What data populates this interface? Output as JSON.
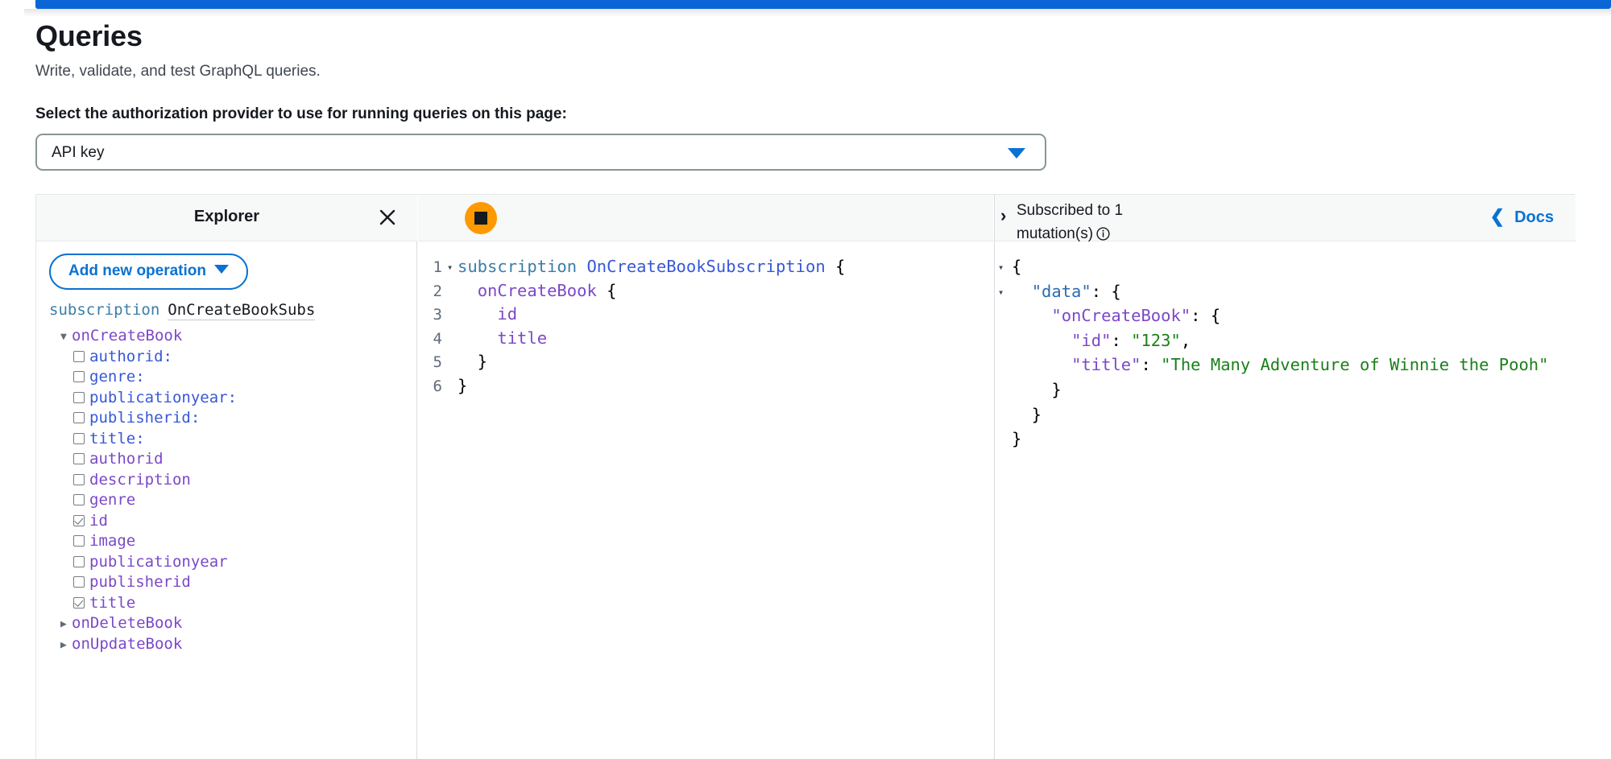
{
  "topbar": {
    "color": "#0a66d6"
  },
  "page": {
    "title": "Queries",
    "subtitle": "Write, validate, and test GraphQL queries.",
    "auth_label": "Select the authorization provider to use for running queries on this page:"
  },
  "auth_select": {
    "value": "API key",
    "options": [
      "API key"
    ],
    "arrow_icon": "chevron-down-icon"
  },
  "explorer": {
    "title": "Explorer",
    "close_icon": "close-icon",
    "add_operation_label": "Add new operation",
    "add_operation_caret": "chevron-down-icon",
    "operation_keyword": "subscription",
    "operation_name": "OnCreateBookSubs",
    "tree": [
      {
        "label": "onCreateBook",
        "kind": "expanded-root",
        "triangle": "▼",
        "color": "purple",
        "level": 0
      },
      {
        "label": "authorid:",
        "kind": "arg",
        "checked": false,
        "color": "blue",
        "level": 1
      },
      {
        "label": "genre:",
        "kind": "arg",
        "checked": false,
        "color": "blue",
        "level": 1
      },
      {
        "label": "publicationyear:",
        "kind": "arg",
        "checked": false,
        "color": "blue",
        "level": 1
      },
      {
        "label": "publisherid:",
        "kind": "arg",
        "checked": false,
        "color": "blue",
        "level": 1
      },
      {
        "label": "title:",
        "kind": "arg",
        "checked": false,
        "color": "blue",
        "level": 1
      },
      {
        "label": "authorid",
        "kind": "field",
        "checked": false,
        "color": "purple",
        "level": 1
      },
      {
        "label": "description",
        "kind": "field",
        "checked": false,
        "color": "purple",
        "level": 1
      },
      {
        "label": "genre",
        "kind": "field",
        "checked": false,
        "color": "purple",
        "level": 1
      },
      {
        "label": "id",
        "kind": "field",
        "checked": true,
        "color": "purple",
        "level": 1
      },
      {
        "label": "image",
        "kind": "field",
        "checked": false,
        "color": "purple",
        "level": 1
      },
      {
        "label": "publicationyear",
        "kind": "field",
        "checked": false,
        "color": "purple",
        "level": 1
      },
      {
        "label": "publisherid",
        "kind": "field",
        "checked": false,
        "color": "purple",
        "level": 1
      },
      {
        "label": "title",
        "kind": "field",
        "checked": true,
        "color": "purple",
        "level": 1
      },
      {
        "label": "onDeleteBook",
        "kind": "collapsed-root",
        "triangle": "▶",
        "color": "purple",
        "level": 0
      },
      {
        "label": "onUpdateBook",
        "kind": "collapsed-root",
        "triangle": "▶",
        "color": "purple",
        "level": 0
      }
    ]
  },
  "editor": {
    "stop_button_icon": "stop-icon",
    "stop_button_color": "#ff9900",
    "lines": [
      {
        "number": "1",
        "fold": "▾",
        "text": "subscription OnCreateBookSubscription {"
      },
      {
        "number": "2",
        "fold": "",
        "text": "  onCreateBook {"
      },
      {
        "number": "3",
        "fold": "",
        "text": "    id"
      },
      {
        "number": "4",
        "fold": "",
        "text": "    title"
      },
      {
        "number": "5",
        "fold": "",
        "text": "  }"
      },
      {
        "number": "6",
        "fold": "",
        "text": "}"
      }
    ]
  },
  "result": {
    "left_chevron": "›",
    "status_text": "Subscribed to 1 mutation(s)",
    "info_icon": "info-icon",
    "docs_label": "Docs",
    "docs_chevron": "chevron-left-icon",
    "json": {
      "data": {
        "onCreateBook": {
          "id": "123",
          "title": "The Many Adventure of Winnie the Pooh"
        }
      }
    },
    "lines": [
      {
        "fold": "▾",
        "text": "{"
      },
      {
        "fold": "▾",
        "text": "  \"data\": {"
      },
      {
        "fold": "",
        "text": "    \"onCreateBook\": {"
      },
      {
        "fold": "",
        "text": "      \"id\": \"123\","
      },
      {
        "fold": "",
        "text": "      \"title\": \"The Many Adventure of Winnie the Pooh\""
      },
      {
        "fold": "",
        "text": "    }"
      },
      {
        "fold": "",
        "text": "  }"
      },
      {
        "fold": "",
        "text": "}"
      }
    ]
  }
}
